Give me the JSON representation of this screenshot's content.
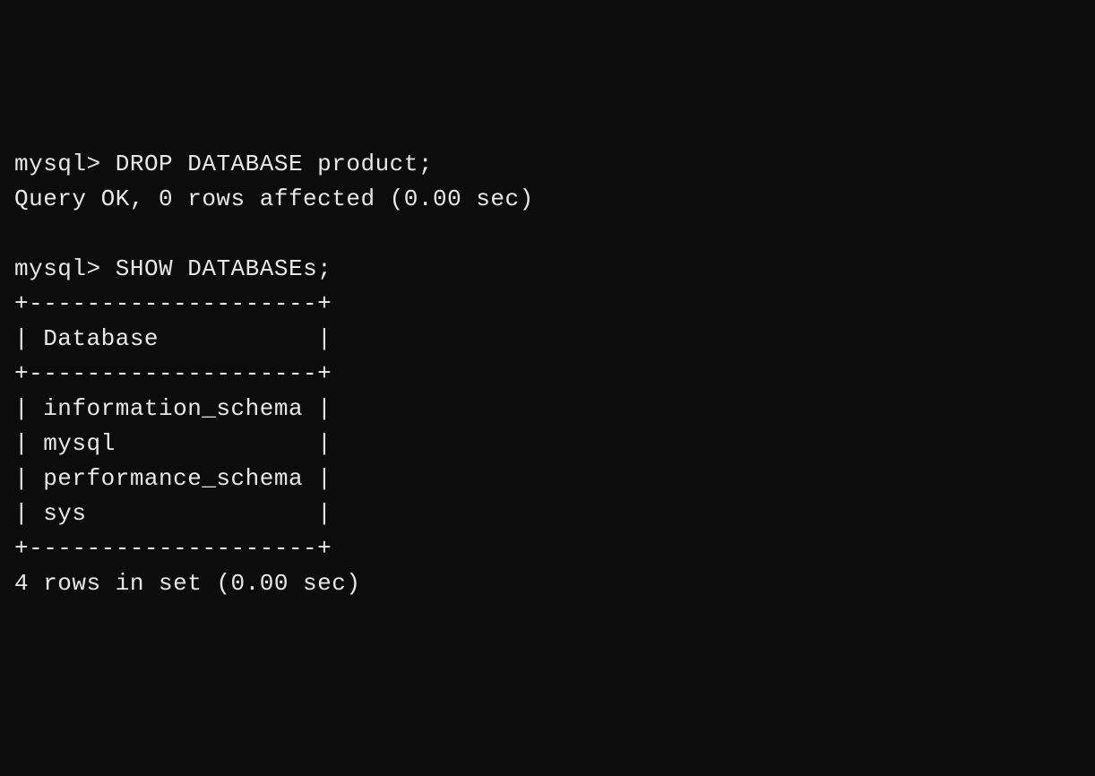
{
  "terminal": {
    "prompt": "mysql>",
    "command1": "DROP DATABASE product;",
    "result1": "Query OK, 0 rows affected (0.00 sec)",
    "command2": "SHOW DATABASEs;",
    "table_border": "+--------------------+",
    "table_header": "| Database           |",
    "table_rows": [
      "| information_schema |",
      "| mysql              |",
      "| performance_schema |",
      "| sys                |"
    ],
    "result2": "4 rows in set (0.00 sec)"
  }
}
